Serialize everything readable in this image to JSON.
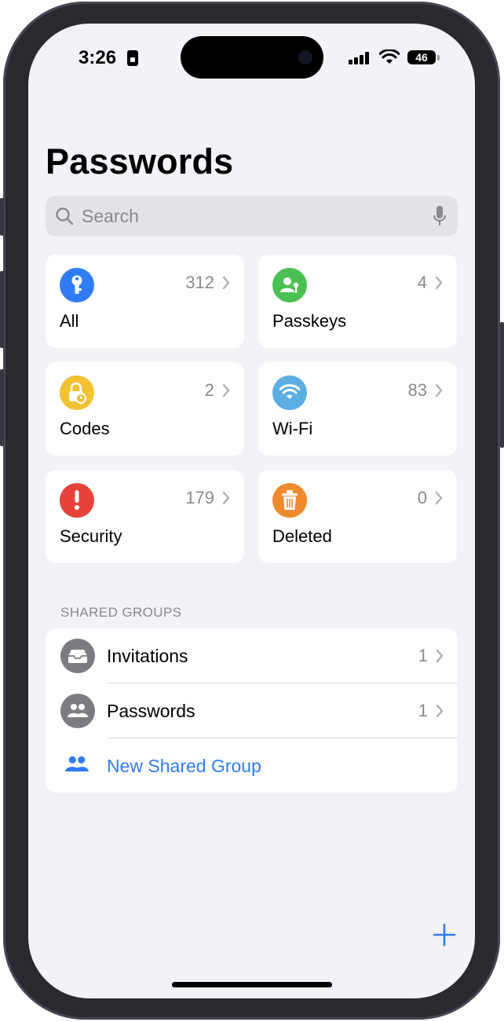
{
  "status_bar": {
    "time": "3:26",
    "battery": "46"
  },
  "header": {
    "title": "Passwords"
  },
  "search": {
    "placeholder": "Search"
  },
  "categories": [
    {
      "label": "All",
      "count": "312",
      "icon": "key-icon",
      "color": "#2f7cf6"
    },
    {
      "label": "Passkeys",
      "count": "4",
      "icon": "passkey-person-icon",
      "color": "#4cc153"
    },
    {
      "label": "Codes",
      "count": "2",
      "icon": "lock-clock-icon",
      "color": "#f2c232"
    },
    {
      "label": "Wi-Fi",
      "count": "83",
      "icon": "wifi-icon",
      "color": "#5aaee2"
    },
    {
      "label": "Security",
      "count": "179",
      "icon": "exclamation-icon",
      "color": "#e6423a"
    },
    {
      "label": "Deleted",
      "count": "0",
      "icon": "trash-icon",
      "color": "#ef8a2e"
    }
  ],
  "shared_groups": {
    "header": "SHARED GROUPS",
    "items": [
      {
        "label": "Invitations",
        "count": "1",
        "icon": "inbox-tray-icon"
      },
      {
        "label": "Passwords",
        "count": "1",
        "icon": "people-icon"
      }
    ],
    "new_group_label": "New Shared Group"
  },
  "colors": {
    "accent": "#2f7cf6",
    "background": "#f2f2f7",
    "secondary_text": "#8a8a8e"
  }
}
